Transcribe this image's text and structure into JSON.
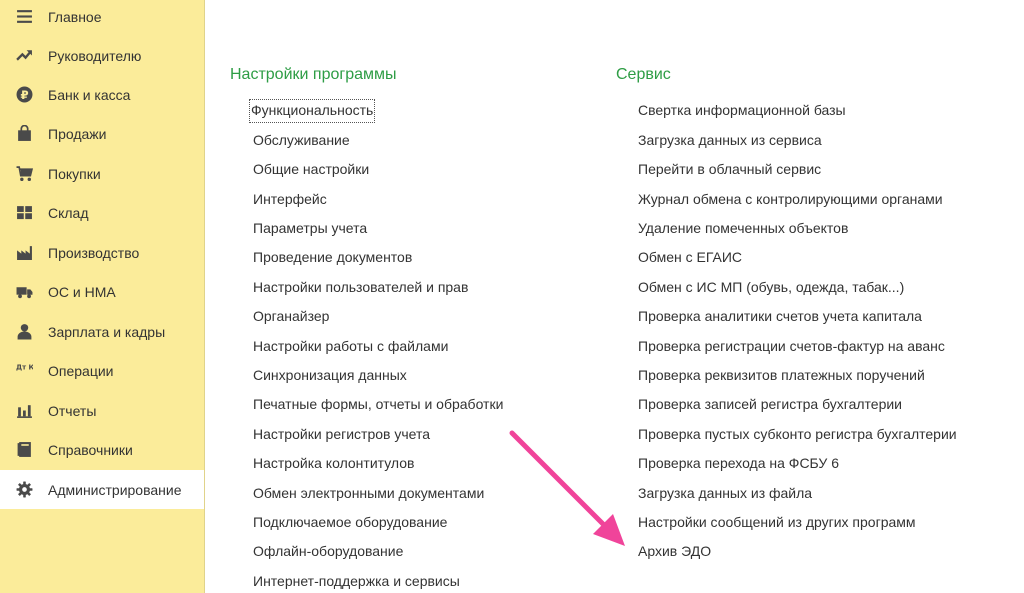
{
  "sidebar": {
    "items": [
      {
        "label": "Главное"
      },
      {
        "label": "Руководителю"
      },
      {
        "label": "Банк и касса"
      },
      {
        "label": "Продажи"
      },
      {
        "label": "Покупки"
      },
      {
        "label": "Склад"
      },
      {
        "label": "Производство"
      },
      {
        "label": "ОС и НМА"
      },
      {
        "label": "Зарплата и кадры"
      },
      {
        "label": "Операции"
      },
      {
        "label": "Отчеты"
      },
      {
        "label": "Справочники"
      },
      {
        "label": "Администрирование"
      }
    ],
    "active_index": 12,
    "bank_icon_glyph": "₽",
    "operations_icon_glyph": "Дт Кт"
  },
  "settings": {
    "title": "Настройки программы",
    "links": [
      "Функциональность",
      "Обслуживание",
      "Общие настройки",
      "Интерфейс",
      "Параметры учета",
      "Проведение документов",
      "Настройки пользователей и прав",
      "Органайзер",
      "Настройки работы с файлами",
      "Синхронизация данных",
      "Печатные формы, отчеты и обработки",
      "Настройки регистров учета",
      "Настройка колонтитулов",
      "Обмен электронными документами",
      "Подключаемое оборудование",
      "Офлайн-оборудование",
      "Интернет-поддержка и сервисы"
    ]
  },
  "service": {
    "title": "Сервис",
    "links": [
      "Свертка информационной базы",
      "Загрузка данных из сервиса",
      "Перейти в облачный сервис",
      "Журнал обмена с контролирующими органами",
      "Удаление помеченных объектов",
      "Обмен с ЕГАИС",
      "Обмен с ИС МП (обувь, одежда, табак...)",
      "Проверка аналитики счетов учета капитала",
      "Проверка регистрации счетов-фактур на аванс",
      "Проверка реквизитов платежных поручений",
      "Проверка записей регистра бухгалтерии",
      "Проверка пустых субконто регистра бухгалтерии",
      "Проверка перехода на ФСБУ 6",
      "Загрузка данных из файла",
      "Настройки сообщений из других программ",
      "Архив ЭДО"
    ]
  },
  "colors": {
    "sidebar_bg": "#fbec9a",
    "section_title": "#2e9d45",
    "arrow": "#f0449a"
  }
}
